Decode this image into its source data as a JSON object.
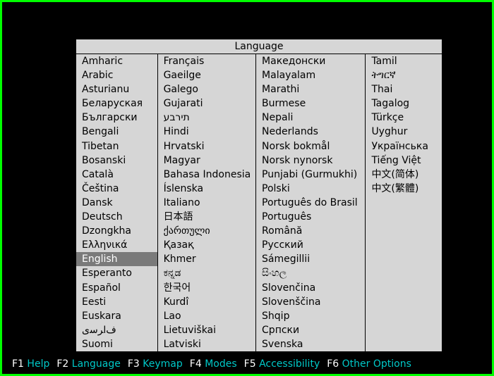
{
  "title": "Language",
  "selected": "English",
  "columns": [
    [
      "Amharic",
      "Arabic",
      "Asturianu",
      "Беларуская",
      "Български",
      "Bengali",
      "Tibetan",
      "Bosanski",
      "Català",
      "Čeština",
      "Dansk",
      "Deutsch",
      "Dzongkha",
      "Ελληνικά",
      "English",
      "Esperanto",
      "Español",
      "Eesti",
      "Euskara",
      "ﻑﺍﺮﺳی",
      "Suomi"
    ],
    [
      "Français",
      "Gaeilge",
      "Galego",
      "Gujarati",
      "תירבע",
      "Hindi",
      "Hrvatski",
      "Magyar",
      "Bahasa Indonesia",
      "Íslenska",
      "Italiano",
      "日本語",
      "ქართული",
      "Қазақ",
      "Khmer",
      "ಕನ್ನಡ",
      "한국어",
      "Kurdî",
      "Lao",
      "Lietuviškai",
      "Latviski"
    ],
    [
      "Македонски",
      "Malayalam",
      "Marathi",
      "Burmese",
      "Nepali",
      "Nederlands",
      "Norsk bokmål",
      "Norsk nynorsk",
      "Punjabi (Gurmukhi)",
      "Polski",
      "Português do Brasil",
      "Português",
      "Română",
      "Русский",
      "Sámegillii",
      "සිංහල",
      "Slovenčina",
      "Slovenščina",
      "Shqip",
      "Српски",
      "Svenska"
    ],
    [
      "Tamil",
      "ትግርኛ",
      "Thai",
      "Tagalog",
      "Türkçe",
      "Uyghur",
      "Українська",
      "Tiếng Việt",
      "中文(简体)",
      "中文(繁體)"
    ]
  ],
  "footer": [
    {
      "key": "F1",
      "action": "Help"
    },
    {
      "key": "F2",
      "action": "Language"
    },
    {
      "key": "F3",
      "action": "Keymap"
    },
    {
      "key": "F4",
      "action": "Modes"
    },
    {
      "key": "F5",
      "action": "Accessibility"
    },
    {
      "key": "F6",
      "action": "Other Options"
    }
  ]
}
